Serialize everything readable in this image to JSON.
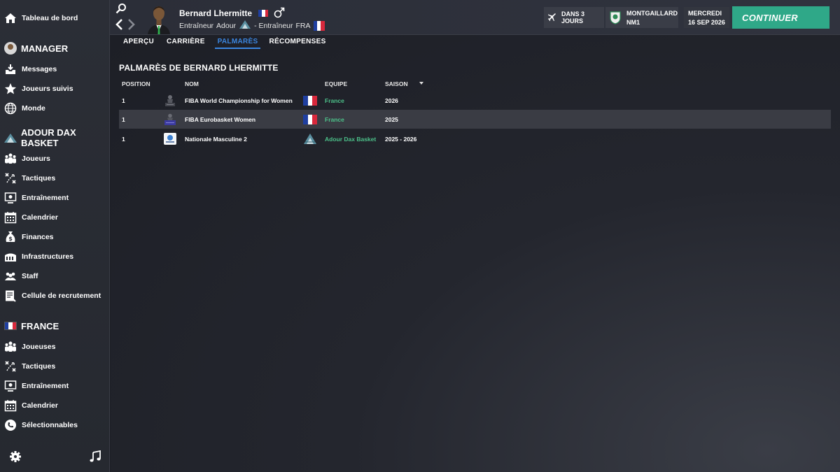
{
  "sidebar": {
    "dashboard": "Tableau de bord",
    "manager_section": "MANAGER",
    "manager_items": [
      {
        "label": "Messages",
        "icon": "inbox-icon"
      },
      {
        "label": "Joueurs suivis",
        "icon": "star-icon"
      },
      {
        "label": "Monde",
        "icon": "globe-icon"
      }
    ],
    "club_section": "ADOUR DAX BASKET",
    "club_items": [
      {
        "label": "Joueurs",
        "icon": "players-icon"
      },
      {
        "label": "Tactiques",
        "icon": "tactics-icon"
      },
      {
        "label": "Entraînement",
        "icon": "training-icon"
      },
      {
        "label": "Calendrier",
        "icon": "calendar-icon"
      },
      {
        "label": "Finances",
        "icon": "finances-icon"
      },
      {
        "label": "Infrastructures",
        "icon": "infrastructure-icon"
      },
      {
        "label": "Staff",
        "icon": "staff-icon"
      },
      {
        "label": "Cellule de recrutement",
        "icon": "scouting-icon"
      }
    ],
    "nation_section": "FRANCE",
    "nation_items": [
      {
        "label": "Joueuses",
        "icon": "players-icon"
      },
      {
        "label": "Tactiques",
        "icon": "tactics-icon"
      },
      {
        "label": "Entraînement",
        "icon": "training-icon"
      },
      {
        "label": "Calendrier",
        "icon": "calendar-icon"
      },
      {
        "label": "Sélectionnables",
        "icon": "phone-icon"
      }
    ]
  },
  "header": {
    "manager_name": "Bernard Lhermitte",
    "subtitle_club_prefix": "Entraîneur",
    "club_short": "Adour",
    "subtitle_nation_prefix": "- Entraîneur",
    "nation_short": "FRA",
    "travel_label": "DANS 3 JOURS",
    "next_opponent": "MONTGAILLARD",
    "next_competition": "NM1",
    "day": "MERCREDI",
    "date": "16 SEP 2026",
    "continue_label": "CONTINUER"
  },
  "tabs": [
    {
      "label": "APERÇU",
      "active": false
    },
    {
      "label": "CARRIÈRE",
      "active": false
    },
    {
      "label": "PALMARÈS",
      "active": true
    },
    {
      "label": "RÉCOMPENSES",
      "active": false
    }
  ],
  "page_title": "PALMARÈS DE BERNARD LHERMITTE",
  "table": {
    "columns": [
      "POSITION",
      "NOM",
      "EQUIPE",
      "SAISON"
    ],
    "rows": [
      {
        "position": "1",
        "name": "FIBA World Championship for Women",
        "team": "France",
        "season": "2026"
      },
      {
        "position": "1",
        "name": "FIBA Eurobasket Women",
        "team": "France",
        "season": "2025"
      },
      {
        "position": "1",
        "name": "Nationale Masculine 2",
        "team": "Adour Dax Basket",
        "season": "2025 - 2026"
      }
    ]
  },
  "colors": {
    "accent_blue": "#3b86e0",
    "continue_green": "#2fa888",
    "team_green": "#4cc089"
  }
}
